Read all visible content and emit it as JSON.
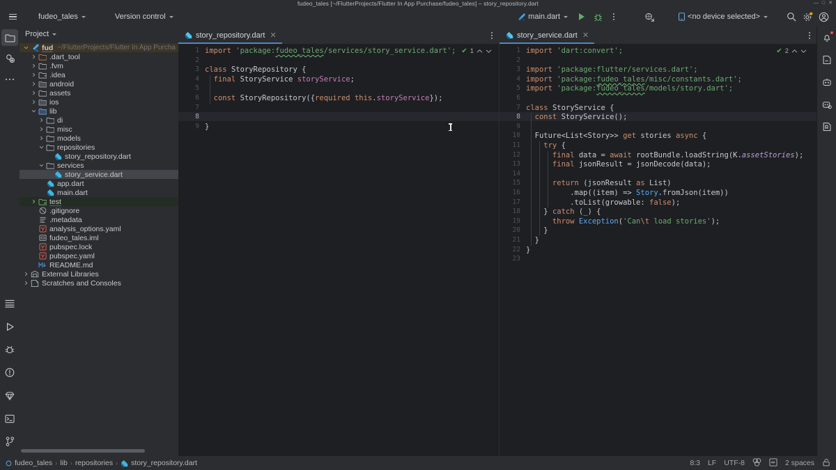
{
  "window": {
    "title": "fudeo_tales [~/FlutterProjects/Flutter In App Purchase/fudeo_tales] – story_repository.dart",
    "minimize": "—",
    "maximize": "□",
    "close": "✕"
  },
  "toolbar": {
    "menu_label": "main-menu",
    "project_chip": "fudeo_tales",
    "vcs_chip": "Version control",
    "run_config": "main.dart",
    "run_label": "Run",
    "debug_label": "Debug",
    "more_label": "More actions",
    "flutter_inspect_label": "Flutter Widget Inspector",
    "device": "<no device selected>",
    "search_label": "Search everywhere",
    "settings_label": "Settings",
    "account_label": "Account"
  },
  "left_stripe": {
    "top": [
      {
        "name": "project-tool-window",
        "label": "Project",
        "active": true
      },
      {
        "name": "commit-tool-window",
        "label": "Commit",
        "active": false
      },
      {
        "name": "more-tool-windows",
        "label": "More tool windows",
        "active": false
      }
    ],
    "bottom": [
      {
        "name": "structure-tool-window",
        "label": "Structure"
      },
      {
        "name": "run-tool-window",
        "label": "Run"
      },
      {
        "name": "debug-tool-window",
        "label": "Debug"
      },
      {
        "name": "problems-tool-window",
        "label": "Problems"
      },
      {
        "name": "dart-analysis-tool-window",
        "label": "Dart Analysis"
      },
      {
        "name": "terminal-tool-window",
        "label": "Terminal"
      },
      {
        "name": "git-tool-window",
        "label": "Git"
      }
    ]
  },
  "right_stripe": [
    {
      "name": "notifications",
      "label": "Notifications",
      "badge": true
    },
    {
      "name": "ai-assistant",
      "label": "AI Assistant",
      "badge": false
    },
    {
      "name": "learn-flutter",
      "label": "Learn",
      "badge": false
    },
    {
      "name": "flutter-outline",
      "label": "Flutter Outline",
      "badge": false
    },
    {
      "name": "bookmarks",
      "label": "Bookmarks",
      "badge": false
    }
  ],
  "project_panel": {
    "title": "Project",
    "root_path": "~/FlutterProjects/Flutter In App Purcha",
    "items": [
      {
        "label": "fudeo_tales",
        "depth": 0,
        "icon": "flutter",
        "arrow": "down",
        "state": "root",
        "bold": true,
        "underline": "amber"
      },
      {
        "label": ".dart_tool",
        "depth": 1,
        "icon": "folder-excluded",
        "arrow": "right",
        "state": "none"
      },
      {
        "label": ".fvm",
        "depth": 1,
        "icon": "folder",
        "arrow": "right",
        "state": "none"
      },
      {
        "label": ".idea",
        "depth": 1,
        "icon": "folder-module",
        "arrow": "right",
        "state": "none"
      },
      {
        "label": "android",
        "depth": 1,
        "icon": "folder-dark",
        "arrow": "right",
        "state": "none"
      },
      {
        "label": "assets",
        "depth": 1,
        "icon": "folder",
        "arrow": "right",
        "state": "none"
      },
      {
        "label": "ios",
        "depth": 1,
        "icon": "folder-dark",
        "arrow": "right",
        "state": "none"
      },
      {
        "label": "lib",
        "depth": 1,
        "icon": "folder-source",
        "arrow": "down",
        "state": "none"
      },
      {
        "label": "di",
        "depth": 2,
        "icon": "folder",
        "arrow": "right",
        "state": "none"
      },
      {
        "label": "misc",
        "depth": 2,
        "icon": "folder",
        "arrow": "right",
        "state": "none"
      },
      {
        "label": "models",
        "depth": 2,
        "icon": "folder",
        "arrow": "right",
        "state": "none"
      },
      {
        "label": "repositories",
        "depth": 2,
        "icon": "folder",
        "arrow": "down",
        "state": "none"
      },
      {
        "label": "story_repository.dart",
        "depth": 3,
        "icon": "dart",
        "arrow": "none",
        "state": "none"
      },
      {
        "label": "services",
        "depth": 2,
        "icon": "folder",
        "arrow": "down",
        "state": "none"
      },
      {
        "label": "story_service.dart",
        "depth": 3,
        "icon": "dart",
        "arrow": "none",
        "state": "selected"
      },
      {
        "label": "app.dart",
        "depth": 2,
        "icon": "dart",
        "arrow": "none",
        "state": "none"
      },
      {
        "label": "main.dart",
        "depth": 2,
        "icon": "dart",
        "arrow": "none",
        "state": "none"
      },
      {
        "label": "test",
        "depth": 1,
        "icon": "folder-test",
        "arrow": "right",
        "state": "testroot",
        "underline": "green"
      },
      {
        "label": ".gitignore",
        "depth": 1,
        "icon": "gitignore",
        "arrow": "none",
        "state": "none"
      },
      {
        "label": ".metadata",
        "depth": 1,
        "icon": "text",
        "arrow": "none",
        "state": "none"
      },
      {
        "label": "analysis_options.yaml",
        "depth": 1,
        "icon": "yaml",
        "arrow": "none",
        "state": "none"
      },
      {
        "label": "fudeo_tales.iml",
        "depth": 1,
        "icon": "iml",
        "arrow": "none",
        "state": "none"
      },
      {
        "label": "pubspec.lock",
        "depth": 1,
        "icon": "yaml",
        "arrow": "none",
        "state": "none"
      },
      {
        "label": "pubspec.yaml",
        "depth": 1,
        "icon": "yaml",
        "arrow": "none",
        "state": "none"
      },
      {
        "label": "README.md",
        "depth": 1,
        "icon": "markdown",
        "arrow": "none",
        "state": "none"
      },
      {
        "label": "External Libraries",
        "depth": 0,
        "icon": "libraries",
        "arrow": "right",
        "state": "none"
      },
      {
        "label": "Scratches and Consoles",
        "depth": 0,
        "icon": "scratches",
        "arrow": "right",
        "state": "none"
      }
    ]
  },
  "editor_left": {
    "tab": {
      "label": "story_repository.dart",
      "icon": "dart",
      "close": "✕"
    },
    "inspection": {
      "icon": "check",
      "count": "1"
    },
    "caret_line": 8,
    "lines": [
      {
        "n": "1",
        "tokens": [
          {
            "t": "import ",
            "c": "k"
          },
          {
            "t": "'package:",
            "c": "s"
          },
          {
            "t": "fudeo_tales",
            "c": "s u"
          },
          {
            "t": "/services/story_service.dart';",
            "c": "s"
          }
        ]
      },
      {
        "n": "2",
        "tokens": []
      },
      {
        "n": "3",
        "tokens": [
          {
            "t": "class ",
            "c": "k"
          },
          {
            "t": "StoryRepository {",
            "c": "t"
          }
        ]
      },
      {
        "n": "4",
        "tokens": [
          {
            "t": "  final ",
            "c": "k"
          },
          {
            "t": "StoryService ",
            "c": "ty"
          },
          {
            "t": "storyService",
            "c": "p"
          },
          {
            "t": ";",
            "c": "t"
          }
        ]
      },
      {
        "n": "5",
        "tokens": []
      },
      {
        "n": "6",
        "tokens": [
          {
            "t": "  const ",
            "c": "k"
          },
          {
            "t": "StoryRepository({",
            "c": "t"
          },
          {
            "t": "required ",
            "c": "k"
          },
          {
            "t": "this",
            "c": "k"
          },
          {
            "t": ".",
            "c": "t"
          },
          {
            "t": "storyService",
            "c": "p"
          },
          {
            "t": "});",
            "c": "t"
          }
        ]
      },
      {
        "n": "7",
        "tokens": []
      },
      {
        "n": "8",
        "tokens": []
      },
      {
        "n": "9",
        "tokens": [
          {
            "t": "}",
            "c": "t"
          }
        ]
      }
    ]
  },
  "editor_right": {
    "tab": {
      "label": "story_service.dart",
      "icon": "dart",
      "close": "✕"
    },
    "inspection": {
      "icon": "check",
      "count": "2"
    },
    "caret_line": 8,
    "lines": [
      {
        "n": "1",
        "tokens": [
          {
            "t": "import ",
            "c": "k"
          },
          {
            "t": "'dart:convert';",
            "c": "s"
          }
        ]
      },
      {
        "n": "2",
        "tokens": []
      },
      {
        "n": "3",
        "tokens": [
          {
            "t": "import ",
            "c": "k"
          },
          {
            "t": "'package:flutter/services.dart';",
            "c": "s"
          }
        ]
      },
      {
        "n": "4",
        "tokens": [
          {
            "t": "import ",
            "c": "k"
          },
          {
            "t": "'package:",
            "c": "s"
          },
          {
            "t": "fudeo_tales",
            "c": "s u"
          },
          {
            "t": "/misc/constants.dart';",
            "c": "s"
          }
        ]
      },
      {
        "n": "5",
        "tokens": [
          {
            "t": "import ",
            "c": "k"
          },
          {
            "t": "'package:",
            "c": "s"
          },
          {
            "t": "fudeo_tales",
            "c": "s u"
          },
          {
            "t": "/models/story.dart';",
            "c": "s"
          }
        ]
      },
      {
        "n": "6",
        "tokens": []
      },
      {
        "n": "7",
        "tokens": [
          {
            "t": "class ",
            "c": "k"
          },
          {
            "t": "StoryService {",
            "c": "t"
          }
        ]
      },
      {
        "n": "8",
        "tokens": [
          {
            "t": "  const ",
            "c": "k"
          },
          {
            "t": "StoryService();",
            "c": "t"
          }
        ]
      },
      {
        "n": "9",
        "tokens": []
      },
      {
        "n": "10",
        "tokens": [
          {
            "t": "  Future<List<Story>> ",
            "c": "ty"
          },
          {
            "t": "get ",
            "c": "k"
          },
          {
            "t": "stories ",
            "c": "t"
          },
          {
            "t": "async",
            "c": "k"
          },
          {
            "t": " {",
            "c": "t"
          }
        ]
      },
      {
        "n": "11",
        "tokens": [
          {
            "t": "    try",
            "c": "k"
          },
          {
            "t": " {",
            "c": "t"
          }
        ]
      },
      {
        "n": "12",
        "tokens": [
          {
            "t": "      final ",
            "c": "k"
          },
          {
            "t": "data = ",
            "c": "t"
          },
          {
            "t": "await ",
            "c": "k"
          },
          {
            "t": "rootBundle.loadString(K.",
            "c": "t"
          },
          {
            "t": "assetStories",
            "c": "fi"
          },
          {
            "t": ");",
            "c": "t"
          }
        ]
      },
      {
        "n": "13",
        "tokens": [
          {
            "t": "      final ",
            "c": "k"
          },
          {
            "t": "jsonResult = jsonDecode(data);",
            "c": "t"
          }
        ]
      },
      {
        "n": "14",
        "tokens": []
      },
      {
        "n": "15",
        "tokens": [
          {
            "t": "      return ",
            "c": "k"
          },
          {
            "t": "(jsonResult ",
            "c": "t"
          },
          {
            "t": "as ",
            "c": "k"
          },
          {
            "t": "List)",
            "c": "t"
          }
        ]
      },
      {
        "n": "16",
        "tokens": [
          {
            "t": "          .map((item) => ",
            "c": "t"
          },
          {
            "t": "Story",
            "c": "f"
          },
          {
            "t": ".fromJson(item))",
            "c": "t"
          }
        ]
      },
      {
        "n": "17",
        "tokens": [
          {
            "t": "          .toList(growable: ",
            "c": "t"
          },
          {
            "t": "false",
            "c": "k"
          },
          {
            "t": ");",
            "c": "t"
          }
        ]
      },
      {
        "n": "18",
        "tokens": [
          {
            "t": "    } ",
            "c": "t"
          },
          {
            "t": "catch ",
            "c": "k"
          },
          {
            "t": "(_) {",
            "c": "t"
          }
        ]
      },
      {
        "n": "19",
        "tokens": [
          {
            "t": "      throw ",
            "c": "k"
          },
          {
            "t": "Exception",
            "c": "f"
          },
          {
            "t": "(",
            "c": "t"
          },
          {
            "t": "'Can",
            "c": "s"
          },
          {
            "t": "\\t",
            "c": "esc"
          },
          {
            "t": " load stories'",
            "c": "s"
          },
          {
            "t": ");",
            "c": "t"
          }
        ]
      },
      {
        "n": "20",
        "tokens": [
          {
            "t": "    }",
            "c": "t"
          }
        ]
      },
      {
        "n": "21",
        "tokens": [
          {
            "t": "  }",
            "c": "t"
          }
        ]
      },
      {
        "n": "22",
        "tokens": [
          {
            "t": "}",
            "c": "t"
          }
        ]
      },
      {
        "n": "23",
        "tokens": []
      }
    ]
  },
  "status_bar": {
    "breadcrumb": [
      {
        "label": "fudeo_tales",
        "icon": "project"
      },
      {
        "label": "lib",
        "icon": "none"
      },
      {
        "label": "repositories",
        "icon": "none"
      },
      {
        "label": "story_repository.dart",
        "icon": "dart"
      }
    ],
    "separator": "›",
    "caret_position": "8:3",
    "line_separator": "LF",
    "encoding": "UTF-8",
    "indent": "2 spaces",
    "flutter_label": "Flutter",
    "inspections_label": "Inspections",
    "lock_label": "Read-only toggle"
  },
  "colors": {
    "accent": "#4a88c7",
    "panel": "#2b2d30",
    "editor": "#1e1f22",
    "keyword": "#cf8e6d",
    "string": "#6aab73",
    "field": "#c77dbb",
    "call": "#57aaf5",
    "static_field": "#b9a0d5",
    "ok": "#5fa85f",
    "badge": "#e05a4f"
  }
}
